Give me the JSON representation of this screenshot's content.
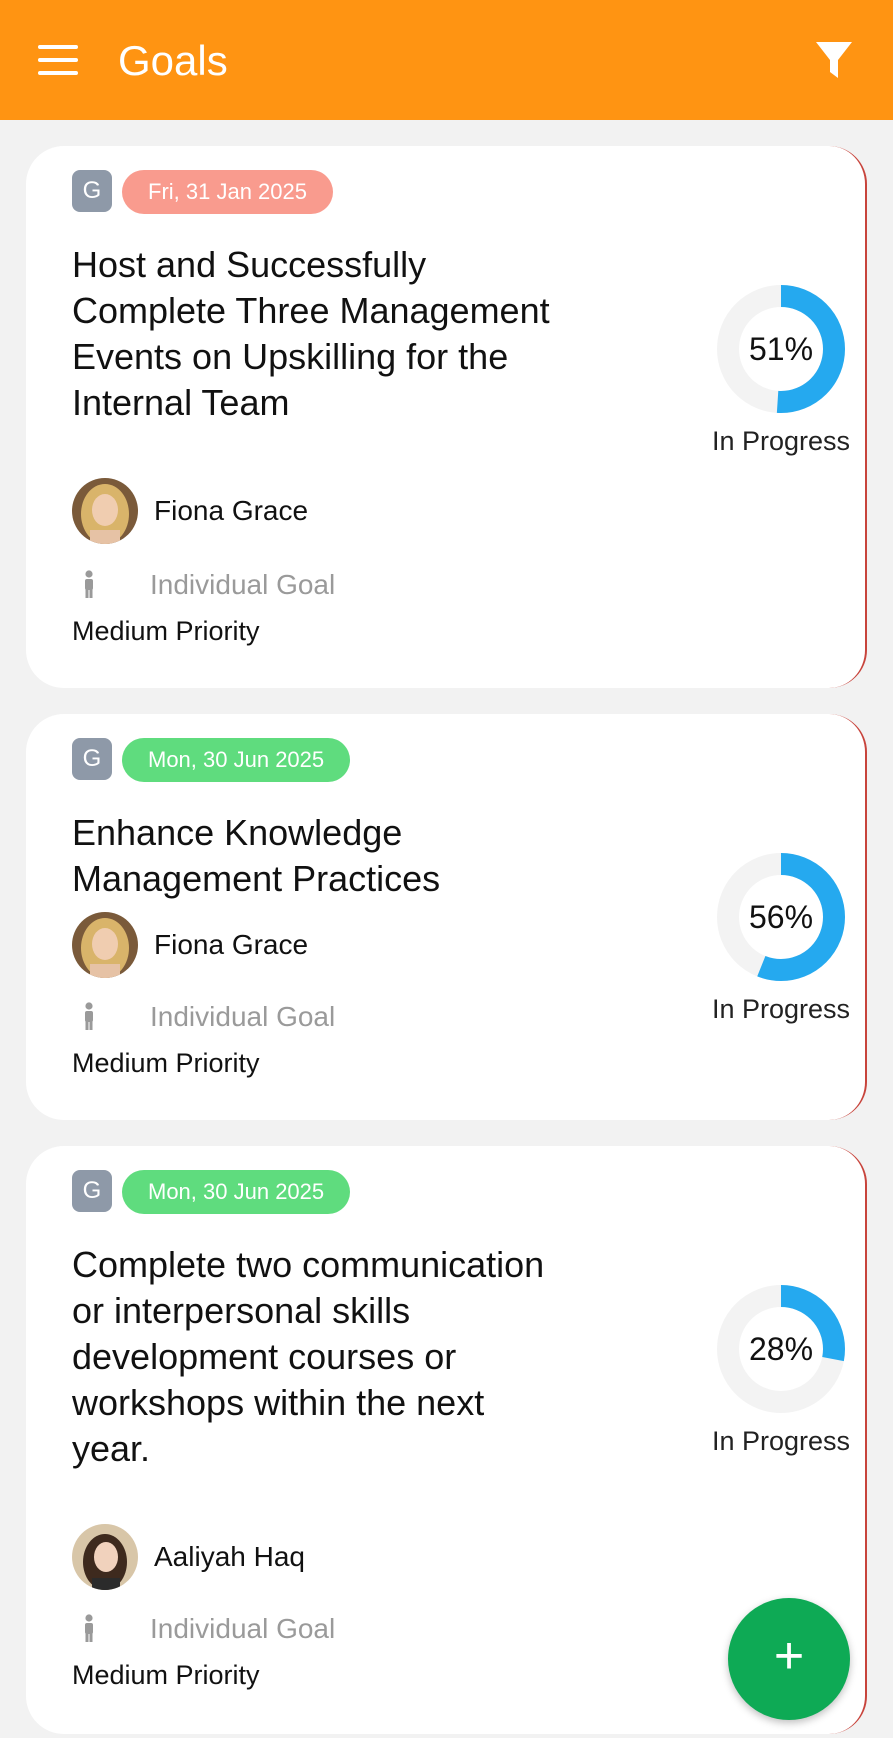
{
  "appbar": {
    "title": "Goals",
    "menu_icon": "hamburger-menu-icon",
    "filter_icon": "filter-funnel-icon",
    "color": "#ff9412"
  },
  "goals": [
    {
      "badge": "G",
      "date": "Fri, 31 Jan 2025",
      "date_color": "#f99b8e",
      "title": "Host and Successfully Complete Three Management Events on Upskilling for the Internal Team",
      "owner": "Fiona Grace",
      "type": "Individual Goal",
      "priority": "Medium Priority",
      "progress_percent": 51,
      "progress_label": "51%",
      "status": "In Progress"
    },
    {
      "badge": "G",
      "date": "Mon, 30 Jun 2025",
      "date_color": "#5fdc7e",
      "title": "Enhance Knowledge Management Practices",
      "owner": "Fiona Grace",
      "type": "Individual Goal",
      "priority": "Medium Priority",
      "progress_percent": 56,
      "progress_label": "56%",
      "status": "In Progress"
    },
    {
      "badge": "G",
      "date": "Mon, 30 Jun 2025",
      "date_color": "#5fdc7e",
      "title": "Complete two communication or interpersonal skills development courses or workshops within the next year.",
      "owner": "Aaliyah Haq",
      "type": "Individual Goal",
      "priority": "Medium Priority",
      "progress_percent": 28,
      "progress_label": "28%",
      "status": "In Progress"
    }
  ],
  "fab": {
    "label": "+",
    "color": "#0eaa55"
  },
  "colors": {
    "ring_fill": "#25a9ef",
    "ring_track": "#f3f3f3"
  }
}
